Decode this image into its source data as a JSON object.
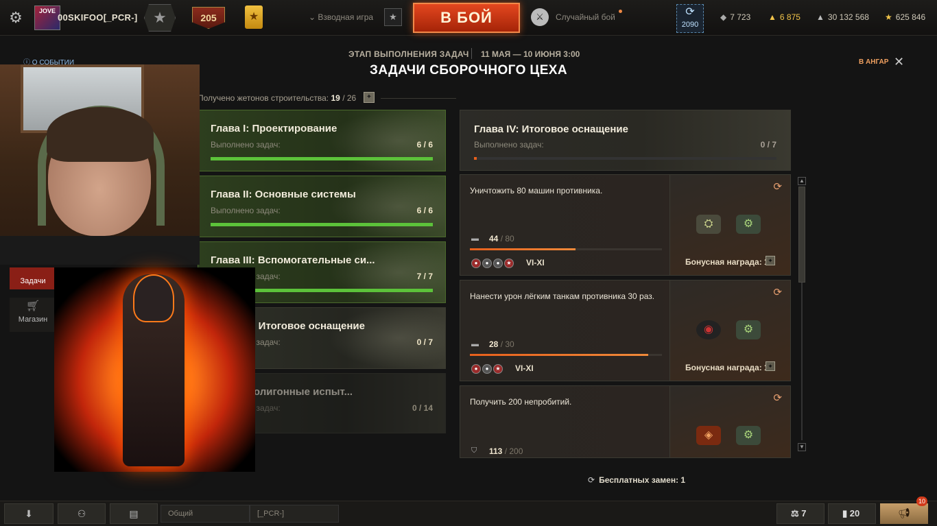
{
  "topbar": {
    "clan_tag": "JOVE",
    "player_name": "00SKIFOO[_PCR-]",
    "level": "205",
    "platoon_label": "Взводная игра",
    "battle_button": "В БОЙ",
    "battle_mode": "Случайный бой",
    "box_count": "2090",
    "currencies": [
      {
        "icon": "bond-icon",
        "value": "7 723"
      },
      {
        "icon": "gold-icon",
        "value": "6 875"
      },
      {
        "icon": "credits-icon",
        "value": "30 132 568"
      },
      {
        "icon": "free-xp-icon",
        "value": "625 846"
      }
    ]
  },
  "header": {
    "event_info": "О СОБЫТИИ",
    "stage": "ЭТАП ВЫПОЛНЕНИЯ ЗАДАЧ",
    "dates": "11 МАЯ — 10 ИЮНЯ 3:00",
    "title": "ЗАДАЧИ СБОРОЧНОГО ЦЕХА",
    "hangar_link": "В АНГАР"
  },
  "tokens": {
    "label": "Получено жетонов строительства:",
    "value": "19",
    "total": "/ 26"
  },
  "chapters": [
    {
      "title": "Глава I: Проектирование",
      "subtitle": "Выполнено задач:",
      "count": "6 / 6",
      "progress": 1.0
    },
    {
      "title": "Глава II: Основные системы",
      "subtitle": "Выполнено задач:",
      "count": "6 / 6",
      "progress": 1.0
    },
    {
      "title": "Глава III: Вспомогательные си...",
      "subtitle": "Выполнено задач:",
      "count": "7 / 7",
      "progress": 1.0
    },
    {
      "title": "Глава IV: Итоговое оснащение",
      "subtitle": "Выполнено задач:",
      "count": "0 / 7",
      "progress": 0
    },
    {
      "title": "Глава: Полигонные испыт...",
      "subtitle": "Выполнено задач:",
      "count": "0 / 14",
      "progress": 0
    }
  ],
  "selected_chapter": {
    "title": "Глава IV: Итоговое оснащение",
    "subtitle": "Выполнено задач:",
    "count": "0 / 7"
  },
  "tasks": [
    {
      "text": "Уничтожить 80 машин противника.",
      "current": "44",
      "total": "/ 80",
      "progress": 0.55,
      "tier": "VI-XI",
      "bonus": "Бонусная награда: 1"
    },
    {
      "text": "Нанести урон лёгким танкам противника 30 раз.",
      "current": "28",
      "total": "/ 30",
      "progress": 0.93,
      "tier": "VI-XI",
      "bonus": "Бонусная награда: 1"
    },
    {
      "text": "Получить 200 непробитий.",
      "current": "113",
      "total": "/ 200",
      "progress": 0.565,
      "tier": "",
      "bonus": ""
    }
  ],
  "free_swaps": "Бесплатных замен: 1",
  "side_nav": {
    "tasks": "Задачи",
    "shop": "Магазин"
  },
  "bottombar": {
    "chat_general": "Общий",
    "chat_clan": "[_PCR-]",
    "stat1": "7",
    "stat2": "20",
    "notifications": "10"
  }
}
